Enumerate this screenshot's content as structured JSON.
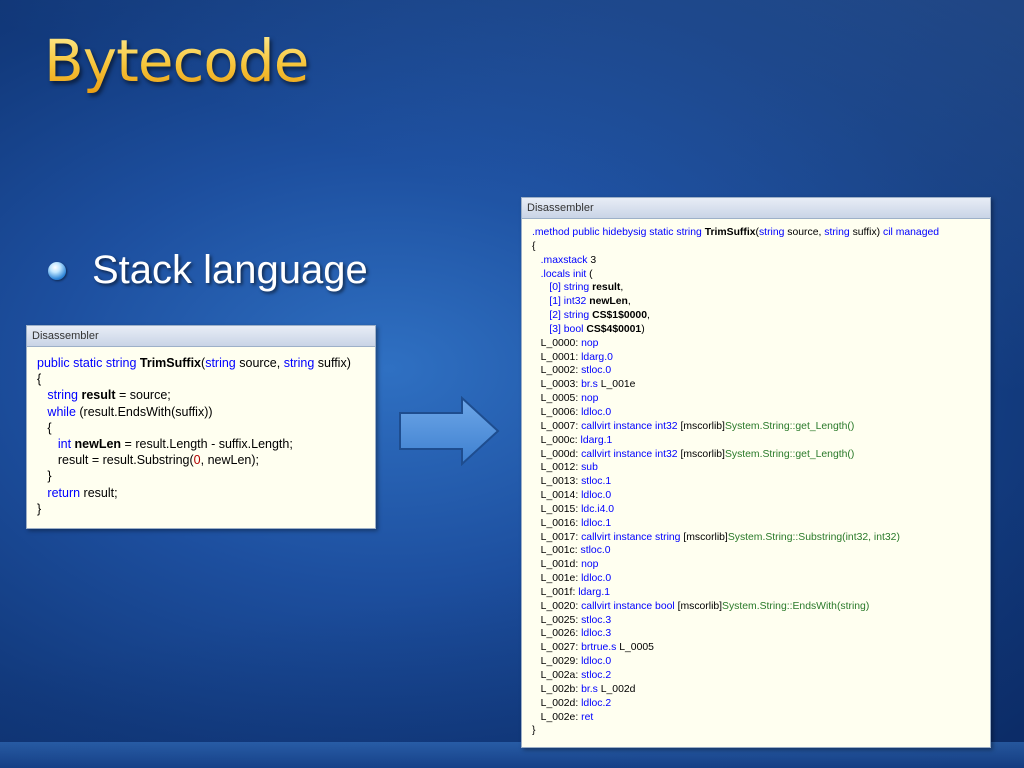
{
  "slide": {
    "title": "Bytecode",
    "bullet": "Stack language"
  },
  "colors": {
    "title_gold": "#f6c43a",
    "background_blue": "#1d4f9f",
    "panel_bg": "#fffff0",
    "keyword": "#0000ff",
    "type": "#2b91af",
    "il_green": "#2a7a2a",
    "number": "#b00000"
  },
  "icons": {
    "bullet": "sphere-bullet-icon",
    "arrow": "right-arrow-icon"
  },
  "csharp_panel": {
    "header": "Disassembler",
    "lines": [
      [
        {
          "t": "public",
          "c": "kw"
        },
        {
          "t": " "
        },
        {
          "t": "static",
          "c": "kw"
        },
        {
          "t": " "
        },
        {
          "t": "string",
          "c": "kw"
        },
        {
          "t": " "
        },
        {
          "t": "TrimSuffix",
          "c": "b"
        },
        {
          "t": "("
        },
        {
          "t": "string",
          "c": "kw"
        },
        {
          "t": " source, "
        },
        {
          "t": "string",
          "c": "kw"
        },
        {
          "t": " suffix)"
        }
      ],
      [
        {
          "t": "{"
        }
      ],
      [
        {
          "t": "   "
        },
        {
          "t": "string",
          "c": "kw"
        },
        {
          "t": " "
        },
        {
          "t": "result",
          "c": "b"
        },
        {
          "t": " = source;"
        }
      ],
      [
        {
          "t": "   "
        },
        {
          "t": "while",
          "c": "kw"
        },
        {
          "t": " (result.EndsWith(suffix))"
        }
      ],
      [
        {
          "t": "   {"
        }
      ],
      [
        {
          "t": "      "
        },
        {
          "t": "int",
          "c": "kw"
        },
        {
          "t": " "
        },
        {
          "t": "newLen",
          "c": "b"
        },
        {
          "t": " = result.Length - suffix.Length;"
        }
      ],
      [
        {
          "t": "      result = result.Substring("
        },
        {
          "t": "0",
          "c": "num"
        },
        {
          "t": ", newLen);"
        }
      ],
      [
        {
          "t": "   }"
        }
      ],
      [
        {
          "t": "   "
        },
        {
          "t": "return",
          "c": "kw"
        },
        {
          "t": " result;"
        }
      ],
      [
        {
          "t": "}"
        }
      ]
    ]
  },
  "il_panel": {
    "header": "Disassembler",
    "lines": [
      [
        {
          "t": ".method public hidebysig static string ",
          "c": "kw"
        },
        {
          "t": "TrimSuffix",
          "c": "b"
        },
        {
          "t": "("
        },
        {
          "t": "string",
          "c": "kw"
        },
        {
          "t": " source, "
        },
        {
          "t": "string",
          "c": "kw"
        },
        {
          "t": " suffix) "
        },
        {
          "t": "cil managed",
          "c": "kw"
        }
      ],
      [
        {
          "t": "{"
        }
      ],
      [
        {
          "t": "   "
        },
        {
          "t": ".maxstack",
          "c": "kw"
        },
        {
          "t": " 3"
        }
      ],
      [
        {
          "t": "   "
        },
        {
          "t": ".locals init",
          "c": "kw"
        },
        {
          "t": " ("
        }
      ],
      [
        {
          "t": "      "
        },
        {
          "t": "[0]",
          "c": "kw"
        },
        {
          "t": " "
        },
        {
          "t": "string",
          "c": "kw"
        },
        {
          "t": " "
        },
        {
          "t": "result",
          "c": "b"
        },
        {
          "t": ","
        }
      ],
      [
        {
          "t": "      "
        },
        {
          "t": "[1]",
          "c": "kw"
        },
        {
          "t": " "
        },
        {
          "t": "int32",
          "c": "kw"
        },
        {
          "t": " "
        },
        {
          "t": "newLen",
          "c": "b"
        },
        {
          "t": ","
        }
      ],
      [
        {
          "t": "      "
        },
        {
          "t": "[2]",
          "c": "kw"
        },
        {
          "t": " "
        },
        {
          "t": "string",
          "c": "kw"
        },
        {
          "t": " "
        },
        {
          "t": "CS$1$0000",
          "c": "b"
        },
        {
          "t": ","
        }
      ],
      [
        {
          "t": "      "
        },
        {
          "t": "[3]",
          "c": "kw"
        },
        {
          "t": " "
        },
        {
          "t": "bool",
          "c": "kw"
        },
        {
          "t": " "
        },
        {
          "t": "CS$4$0001",
          "c": "b"
        },
        {
          "t": ")"
        }
      ],
      [
        {
          "t": "   L_0000: "
        },
        {
          "t": "nop",
          "c": "kw"
        }
      ],
      [
        {
          "t": "   L_0001: "
        },
        {
          "t": "ldarg.0",
          "c": "kw"
        }
      ],
      [
        {
          "t": "   L_0002: "
        },
        {
          "t": "stloc.0",
          "c": "kw"
        }
      ],
      [
        {
          "t": "   L_0003: "
        },
        {
          "t": "br.s",
          "c": "kw"
        },
        {
          "t": " L_001e"
        }
      ],
      [
        {
          "t": "   L_0005: "
        },
        {
          "t": "nop",
          "c": "kw"
        }
      ],
      [
        {
          "t": "   L_0006: "
        },
        {
          "t": "ldloc.0",
          "c": "kw"
        }
      ],
      [
        {
          "t": "   L_0007: "
        },
        {
          "t": "callvirt",
          "c": "kw"
        },
        {
          "t": " "
        },
        {
          "t": "instance",
          "c": "kw"
        },
        {
          "t": " "
        },
        {
          "t": "int32",
          "c": "kw"
        },
        {
          "t": " [mscorlib]"
        },
        {
          "t": "System.String::get_Length()",
          "c": "gr"
        }
      ],
      [
        {
          "t": "   L_000c: "
        },
        {
          "t": "ldarg.1",
          "c": "kw"
        }
      ],
      [
        {
          "t": "   L_000d: "
        },
        {
          "t": "callvirt",
          "c": "kw"
        },
        {
          "t": " "
        },
        {
          "t": "instance",
          "c": "kw"
        },
        {
          "t": " "
        },
        {
          "t": "int32",
          "c": "kw"
        },
        {
          "t": " [mscorlib]"
        },
        {
          "t": "System.String::get_Length()",
          "c": "gr"
        }
      ],
      [
        {
          "t": "   L_0012: "
        },
        {
          "t": "sub",
          "c": "kw"
        }
      ],
      [
        {
          "t": "   L_0013: "
        },
        {
          "t": "stloc.1",
          "c": "kw"
        }
      ],
      [
        {
          "t": "   L_0014: "
        },
        {
          "t": "ldloc.0",
          "c": "kw"
        }
      ],
      [
        {
          "t": "   L_0015: "
        },
        {
          "t": "ldc.i4.0",
          "c": "kw"
        }
      ],
      [
        {
          "t": "   L_0016: "
        },
        {
          "t": "ldloc.1",
          "c": "kw"
        }
      ],
      [
        {
          "t": "   L_0017: "
        },
        {
          "t": "callvirt",
          "c": "kw"
        },
        {
          "t": " "
        },
        {
          "t": "instance",
          "c": "kw"
        },
        {
          "t": " "
        },
        {
          "t": "string",
          "c": "kw"
        },
        {
          "t": " [mscorlib]"
        },
        {
          "t": "System.String::Substring(int32, int32)",
          "c": "gr"
        }
      ],
      [
        {
          "t": "   L_001c: "
        },
        {
          "t": "stloc.0",
          "c": "kw"
        }
      ],
      [
        {
          "t": "   L_001d: "
        },
        {
          "t": "nop",
          "c": "kw"
        }
      ],
      [
        {
          "t": "   L_001e: "
        },
        {
          "t": "ldloc.0",
          "c": "kw"
        }
      ],
      [
        {
          "t": "   L_001f: "
        },
        {
          "t": "ldarg.1",
          "c": "kw"
        }
      ],
      [
        {
          "t": "   L_0020: "
        },
        {
          "t": "callvirt",
          "c": "kw"
        },
        {
          "t": " "
        },
        {
          "t": "instance",
          "c": "kw"
        },
        {
          "t": " "
        },
        {
          "t": "bool",
          "c": "kw"
        },
        {
          "t": " [mscorlib]"
        },
        {
          "t": "System.String::EndsWith(string)",
          "c": "gr"
        }
      ],
      [
        {
          "t": "   L_0025: "
        },
        {
          "t": "stloc.3",
          "c": "kw"
        }
      ],
      [
        {
          "t": "   L_0026: "
        },
        {
          "t": "ldloc.3",
          "c": "kw"
        }
      ],
      [
        {
          "t": "   L_0027: "
        },
        {
          "t": "brtrue.s",
          "c": "kw"
        },
        {
          "t": " L_0005"
        }
      ],
      [
        {
          "t": "   L_0029: "
        },
        {
          "t": "ldloc.0",
          "c": "kw"
        }
      ],
      [
        {
          "t": "   L_002a: "
        },
        {
          "t": "stloc.2",
          "c": "kw"
        }
      ],
      [
        {
          "t": "   L_002b: "
        },
        {
          "t": "br.s",
          "c": "kw"
        },
        {
          "t": " L_002d"
        }
      ],
      [
        {
          "t": "   L_002d: "
        },
        {
          "t": "ldloc.2",
          "c": "kw"
        }
      ],
      [
        {
          "t": "   L_002e: "
        },
        {
          "t": "ret",
          "c": "kw"
        }
      ],
      [
        {
          "t": "}"
        }
      ]
    ]
  }
}
